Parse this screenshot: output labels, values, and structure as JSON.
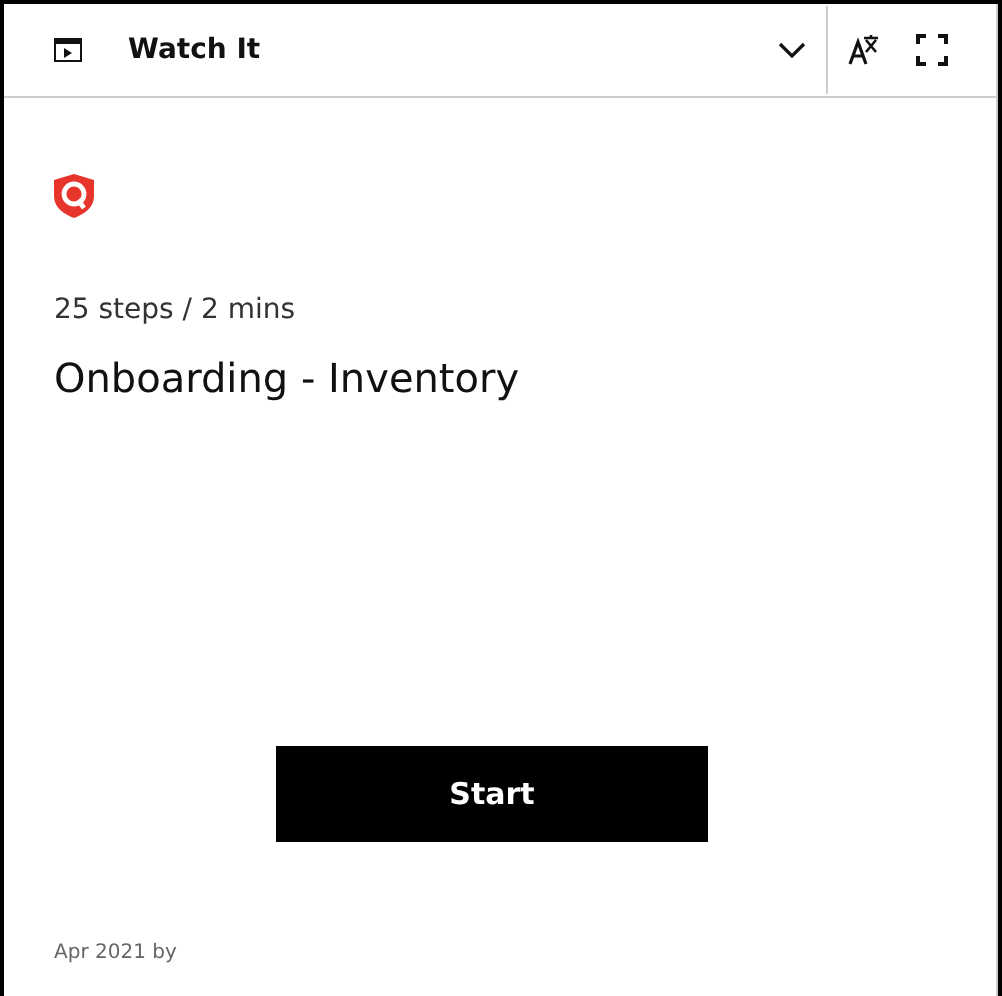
{
  "header": {
    "title": "Watch It"
  },
  "guide": {
    "meta": "25 steps / 2 mins",
    "title": "Onboarding - Inventory",
    "start_button": "Start",
    "footer": "Apr 2021 by"
  }
}
